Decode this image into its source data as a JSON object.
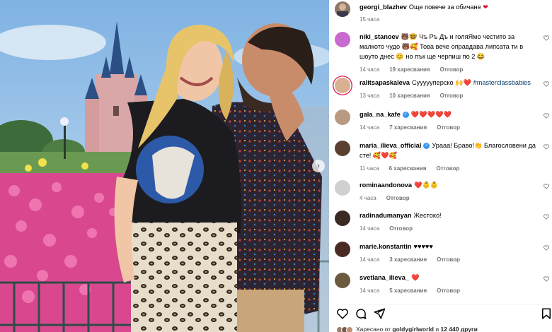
{
  "post": {
    "author": "georgi_blazhev",
    "caption": "Още повече за обичане",
    "time": "15 часа"
  },
  "comments": [
    {
      "user": "niki_stanoev",
      "text": "🐻🤓 Чъ Ръ Дъ и голяЯмо честито за малкото чудо 🐻🥰 Това вече оправдава липсата ти в шоуто днес 😊 но пък ще черпиш по 2 😂",
      "time": "14 часа",
      "likes": "19 харесвания",
      "reply": "Отговор"
    },
    {
      "user": "ralitsapaskaleva",
      "text": "Суууууперско 🙌❤️ ",
      "hashtag": "#masterclassbabies",
      "time": "13 часа",
      "likes": "10 харесвания",
      "reply": "Отговор"
    },
    {
      "user": "gala_na_kafe",
      "text": "❤️❤️❤️❤️❤️",
      "time": "14 часа",
      "likes": "7 харесвания",
      "reply": "Отговор"
    },
    {
      "user": "maria_ilieva_official",
      "text": "Урааа! Браво!👏 Благословени да сте! 🥰❤️🥰",
      "time": "11 часа",
      "likes": "6 харесвания",
      "reply": "Отговор"
    },
    {
      "user": "rominaandonova",
      "text": "❤️👶👶",
      "time": "4 часа",
      "reply": "Отговор"
    },
    {
      "user": "radinadumanyan",
      "text": "Жестоко!",
      "time": "14 часа",
      "reply": "Отговор"
    },
    {
      "user": "marie.konstantin",
      "text": "♥♥♥♥♥",
      "time": "14 часа",
      "likes": "3 харесвания",
      "reply": "Отговор"
    },
    {
      "user": "svetlana_ilieva_",
      "text": "❤️",
      "time": "14 часа",
      "likes": "5 харесвания",
      "reply": "Отговор"
    }
  ],
  "liked_by": {
    "prefix": "Харесано от ",
    "user": "goldygirlworld",
    "mid": " и ",
    "count": "12 440 други"
  },
  "icons": {
    "like": "heart-icon",
    "comment": "comment-icon",
    "share": "share-icon",
    "save": "bookmark-icon",
    "next": "chevron-right-icon"
  },
  "colors": {
    "accent_red": "#e0122b",
    "link_blue": "#00376b",
    "verified_blue": "#3897f0",
    "muted": "#737373"
  }
}
